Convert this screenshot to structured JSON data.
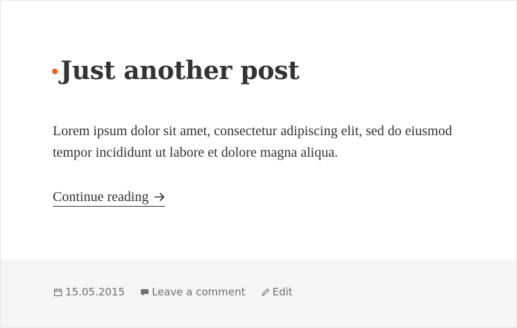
{
  "post": {
    "title": "Just another post",
    "title_accent_color": "#f35a1c",
    "excerpt": "Lorem ipsum dolor sit amet, consectetur adipiscing elit, sed do eiusmod tempor incididunt ut labore et dolore magna aliqua.",
    "continue_label": "Continue reading"
  },
  "footer": {
    "date": "15.05.2015",
    "comment_label": "Leave a comment",
    "edit_label": "Edit",
    "icons": {
      "date": "calendar-icon",
      "comment": "speech-bubble-icon",
      "edit": "pencil-icon",
      "continue": "arrow-right-icon"
    }
  }
}
